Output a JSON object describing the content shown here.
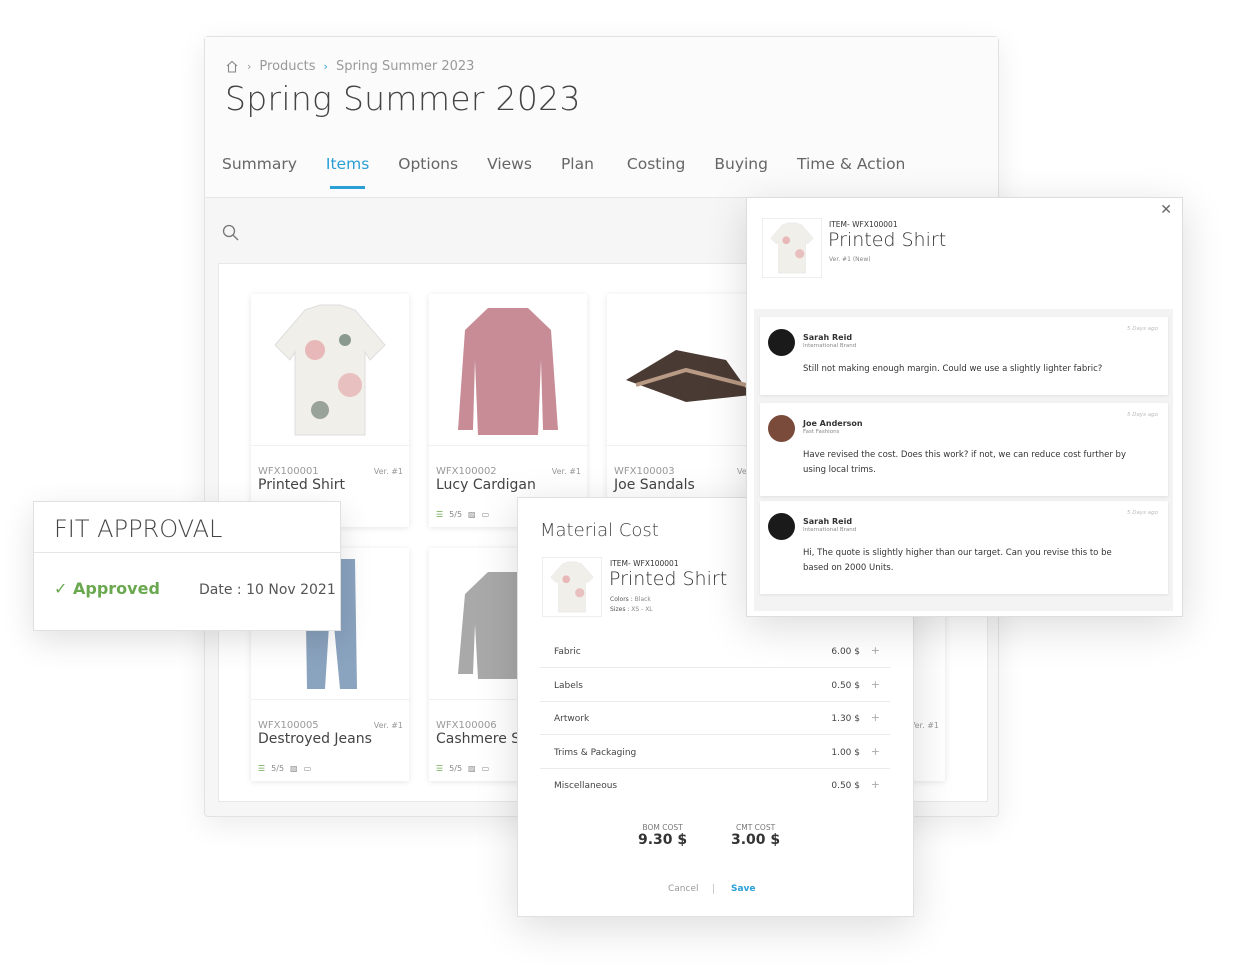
{
  "breadcrumb": {
    "home_icon": "home-icon",
    "items": [
      "Products",
      "Spring Summer 2023"
    ]
  },
  "page_title": "Spring Summer 2023",
  "tabs": [
    {
      "label": "Summary"
    },
    {
      "label": "Items",
      "active": true
    },
    {
      "label": "Options"
    },
    {
      "label": "Views"
    },
    {
      "label": "Plan"
    },
    {
      "label": "Costing"
    },
    {
      "label": "Buying"
    },
    {
      "label": "Time & Action"
    }
  ],
  "accent_color": "#2a9fd6",
  "items": [
    {
      "code": "WFX100001",
      "name": "Printed Shirt",
      "version": "Ver. #1"
    },
    {
      "code": "WFX100002",
      "name": "Lucy Cardigan",
      "version": "Ver. #1",
      "progress": "5/5"
    },
    {
      "code": "WFX100003",
      "name": "Joe Sandals",
      "version": "Ver"
    },
    {
      "code": "WFX100005",
      "name": "Destroyed Jeans",
      "version": "Ver. #1",
      "progress": "5/5"
    },
    {
      "code": "WFX100006",
      "name": "Cashmere Sw",
      "version": "",
      "progress": "5/5"
    },
    {
      "version": "Ver. #1"
    }
  ],
  "fit_approval": {
    "title": "FIT APPROVAL",
    "status": "Approved",
    "date": "Date : 10 Nov 2021",
    "status_color": "#6aa84f"
  },
  "material_cost": {
    "title": "Material Cost",
    "item_code": "ITEM- WFX100001",
    "item_name": "Printed Shirt",
    "colors_label": "Colors :",
    "colors": "Black",
    "sizes_label": "Sizes :",
    "sizes": "XS - XL",
    "rows": [
      {
        "label": "Fabric",
        "value": "6.00 $"
      },
      {
        "label": "Labels",
        "value": "0.50 $"
      },
      {
        "label": "Artwork",
        "value": "1.30 $"
      },
      {
        "label": "Trims & Packaging",
        "value": "1.00 $"
      },
      {
        "label": "Miscellaneous",
        "value": "0.50 $"
      }
    ],
    "bom_label": "BOM COST",
    "bom_value": "9.30 $",
    "cmt_label": "CMT COST",
    "cmt_value": "3.00 $",
    "cancel": "Cancel",
    "save": "Save"
  },
  "comments": {
    "item_code": "ITEM- WFX100001",
    "item_name": "Printed Shirt",
    "version": "Ver. #1 (New)",
    "messages": [
      {
        "name": "Sarah Reid",
        "org": "International Brand",
        "ago": "5 Days ago",
        "text": "Still not making enough margin. Could we use a slightly lighter fabric?"
      },
      {
        "name": "Joe Anderson",
        "org": "Fast Fashions",
        "ago": "5 Days ago",
        "text": "Have revised the cost. Does this work? if not, we can reduce cost further by using local trims."
      },
      {
        "name": "Sarah Reid",
        "org": "International Brand",
        "ago": "5 Days ago",
        "text": "Hi, The quote is slightly higher than our target. Can you revise this to be based on 2000 Units."
      }
    ]
  }
}
